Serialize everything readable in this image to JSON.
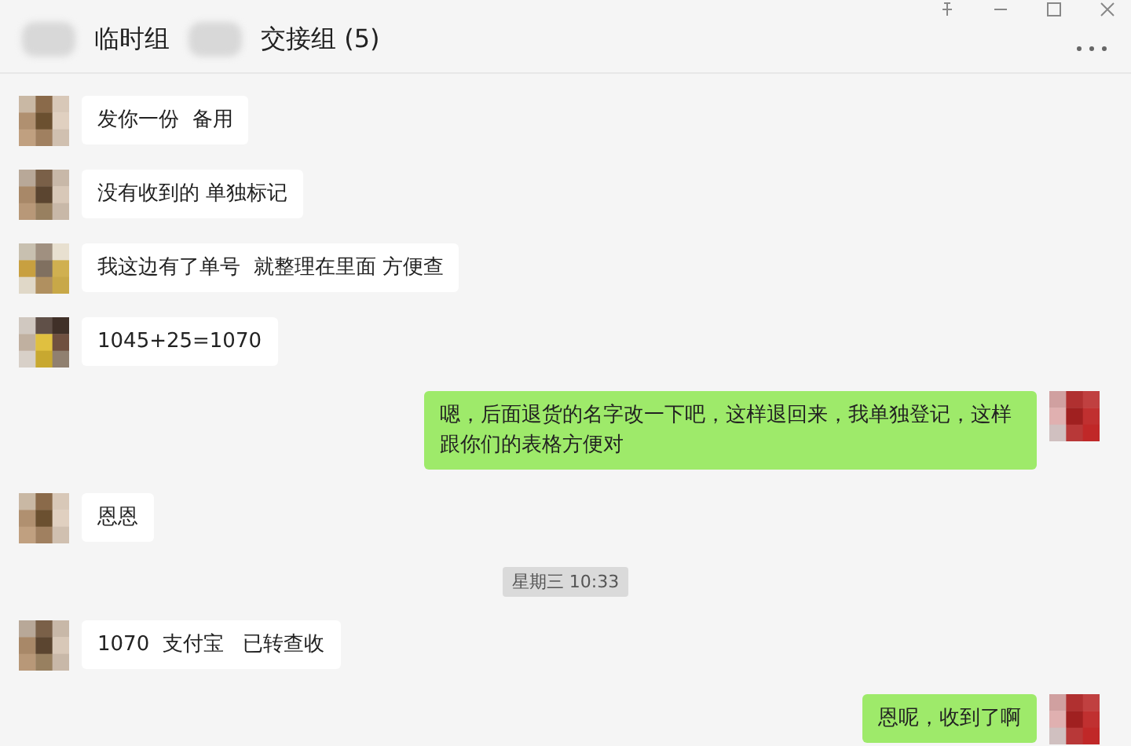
{
  "window": {
    "title_parts": [
      "临时组",
      "交接组 (5)"
    ]
  },
  "messages": [
    {
      "kind": "received",
      "text": "发你一份  备用"
    },
    {
      "kind": "received",
      "text": "没有收到的 单独标记"
    },
    {
      "kind": "received",
      "text": "我这边有了单号  就整理在里面 方便查"
    },
    {
      "kind": "received",
      "text": "1045+25=1070"
    },
    {
      "kind": "sent",
      "text": "嗯，后面退货的名字改一下吧，这样退回来，我单独登记，这样跟你们的表格方便对"
    },
    {
      "kind": "received",
      "text": "恩恩"
    },
    {
      "kind": "time",
      "text": "星期三 10:33"
    },
    {
      "kind": "received",
      "text": "1070  支付宝   已转查收"
    },
    {
      "kind": "sent",
      "text": "恩呢，收到了啊"
    }
  ]
}
